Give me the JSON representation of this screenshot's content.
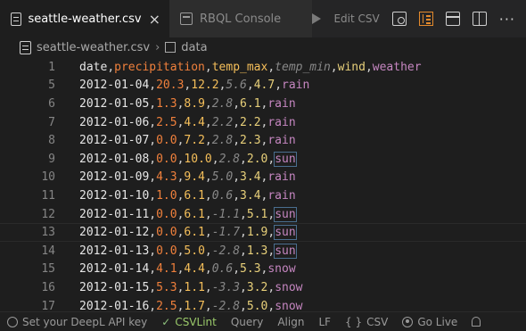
{
  "tabs": [
    {
      "label": "seattle-weather.csv",
      "active": true
    },
    {
      "label": "RBQL Console",
      "active": false
    }
  ],
  "toolbar": {
    "edit_csv_label": "Edit CSV"
  },
  "breadcrumb": {
    "file": "seattle-weather.csv",
    "symbol": "data"
  },
  "editor": {
    "lines": [
      {
        "n": "1",
        "cells": [
          "date",
          "precipitation",
          "temp_max",
          "temp_min",
          "wind",
          "weather"
        ]
      },
      {
        "n": "5",
        "cells": [
          "2012-01-04",
          "20.3",
          "12.2",
          "5.6",
          "4.7",
          "rain"
        ]
      },
      {
        "n": "6",
        "cells": [
          "2012-01-05",
          "1.3",
          "8.9",
          "2.8",
          "6.1",
          "rain"
        ]
      },
      {
        "n": "7",
        "cells": [
          "2012-01-06",
          "2.5",
          "4.4",
          "2.2",
          "2.2",
          "rain"
        ]
      },
      {
        "n": "8",
        "cells": [
          "2012-01-07",
          "0.0",
          "7.2",
          "2.8",
          "2.3",
          "rain"
        ]
      },
      {
        "n": "9",
        "cells": [
          "2012-01-08",
          "0.0",
          "10.0",
          "2.8",
          "2.0",
          "sun"
        ]
      },
      {
        "n": "10",
        "cells": [
          "2012-01-09",
          "4.3",
          "9.4",
          "5.0",
          "3.4",
          "rain"
        ]
      },
      {
        "n": "11",
        "cells": [
          "2012-01-10",
          "1.0",
          "6.1",
          "0.6",
          "3.4",
          "rain"
        ]
      },
      {
        "n": "12",
        "cells": [
          "2012-01-11",
          "0.0",
          "6.1",
          "-1.1",
          "5.1",
          "sun"
        ]
      },
      {
        "n": "13",
        "cells": [
          "2012-01-12",
          "0.0",
          "6.1",
          "-1.7",
          "1.9",
          "sun"
        ]
      },
      {
        "n": "14",
        "cells": [
          "2012-01-13",
          "0.0",
          "5.0",
          "-2.8",
          "1.3",
          "sun"
        ]
      },
      {
        "n": "15",
        "cells": [
          "2012-01-14",
          "4.1",
          "4.4",
          "0.6",
          "5.3",
          "snow"
        ]
      },
      {
        "n": "16",
        "cells": [
          "2012-01-15",
          "5.3",
          "1.1",
          "-3.3",
          "3.2",
          "snow"
        ]
      },
      {
        "n": "17",
        "cells": [
          "2012-01-16",
          "2.5",
          "1.7",
          "-2.8",
          "5.0",
          "snow"
        ]
      }
    ],
    "current_line": "13",
    "highlighted_word": "sun"
  },
  "statusbar": {
    "deepl": "Set your DeepL API key",
    "csvlint": "CSVLint",
    "query": "Query",
    "align": "Align",
    "eol": "LF",
    "language": "CSV",
    "golive": "Go Live"
  },
  "colors": {
    "col0": "#e6e6e6",
    "col1": "#f0803c",
    "col2": "#f5bf5a",
    "col3": "#888888",
    "col4": "#e8d07a",
    "col5": "#c586c0",
    "csvlint": "#9ac96a"
  }
}
